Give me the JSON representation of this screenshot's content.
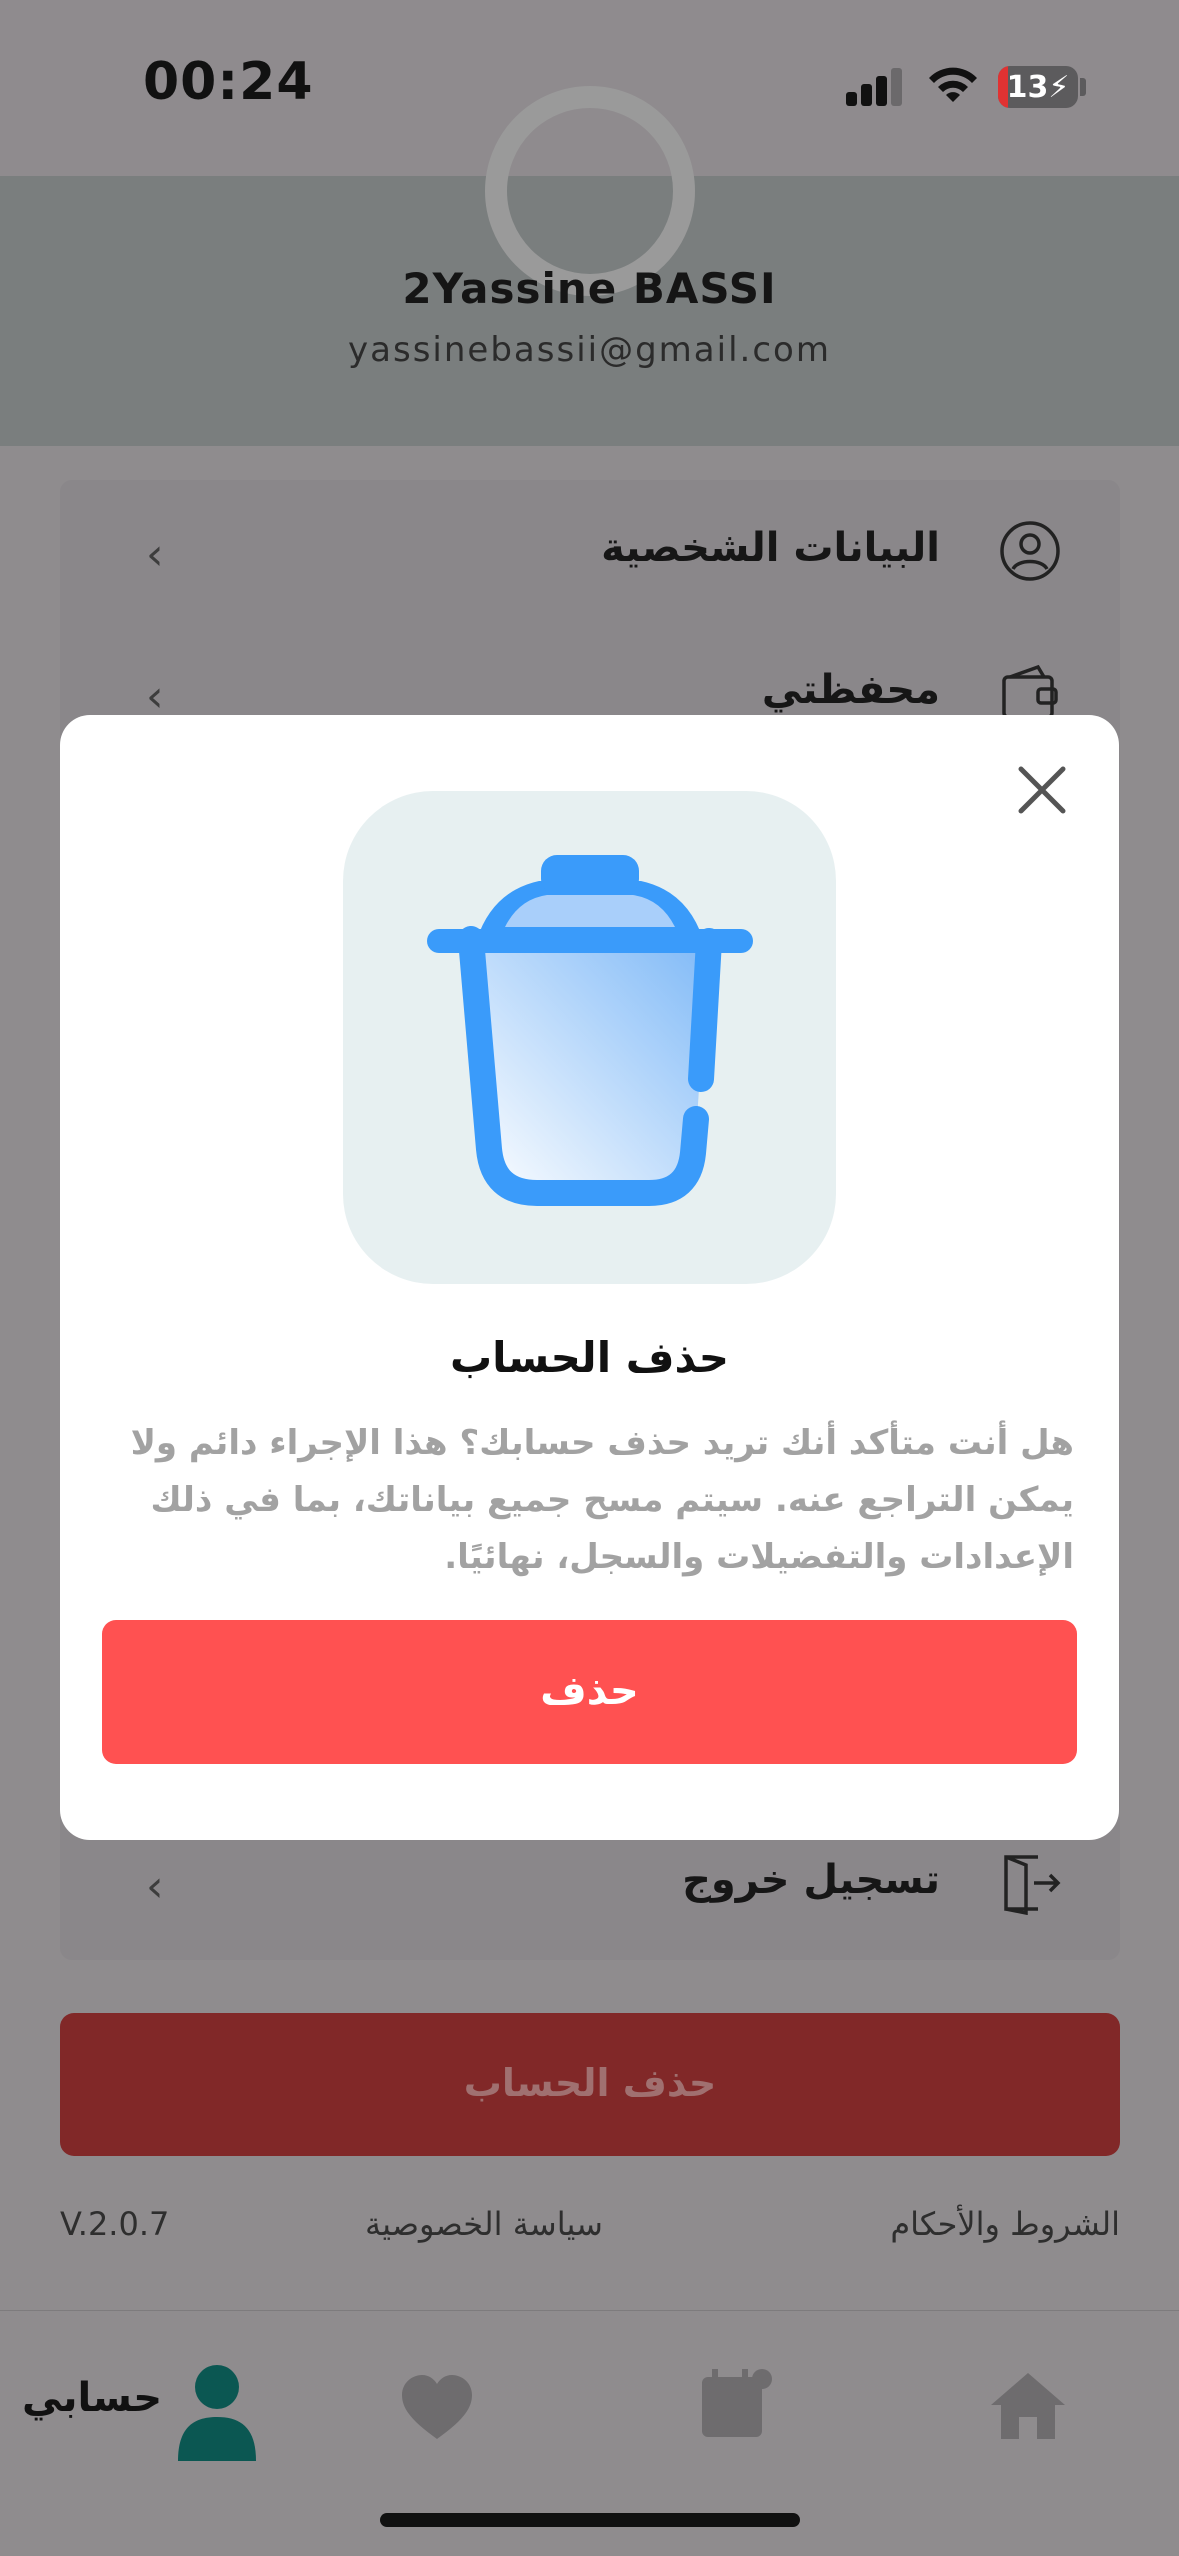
{
  "status_bar": {
    "time": "00:24",
    "battery": "13"
  },
  "profile": {
    "name": "2Yassine BASSI",
    "email": "yassinebassii@gmail.com"
  },
  "menu": {
    "items": [
      {
        "label": "البيانات الشخصية",
        "icon": "user-circle-icon"
      },
      {
        "label": "محفظتي",
        "icon": "wallet-icon"
      },
      {
        "label": "تسجيل خروج",
        "icon": "logout-icon"
      }
    ]
  },
  "delete_account_label": "حذف الحساب",
  "footer": {
    "version": "V.2.0.7",
    "privacy": "سياسة الخصوصية",
    "terms": "الشروط والأحكام"
  },
  "tabbar": {
    "account_label": "حسابي"
  },
  "modal": {
    "title": "حذف الحساب",
    "message": "هل أنت متأكد أنك تريد حذف حسابك؟ هذا الإجراء دائم ولا يمكن التراجع عنه. سيتم مسح جميع بياناتك، بما في ذلك الإعدادات والتفضيلات والسجل، نهائيًا.",
    "confirm_label": "حذف"
  },
  "colors": {
    "danger": "#ff5151",
    "icon_blue": "#3a9bfa",
    "accent_teal": "#0b5752"
  }
}
